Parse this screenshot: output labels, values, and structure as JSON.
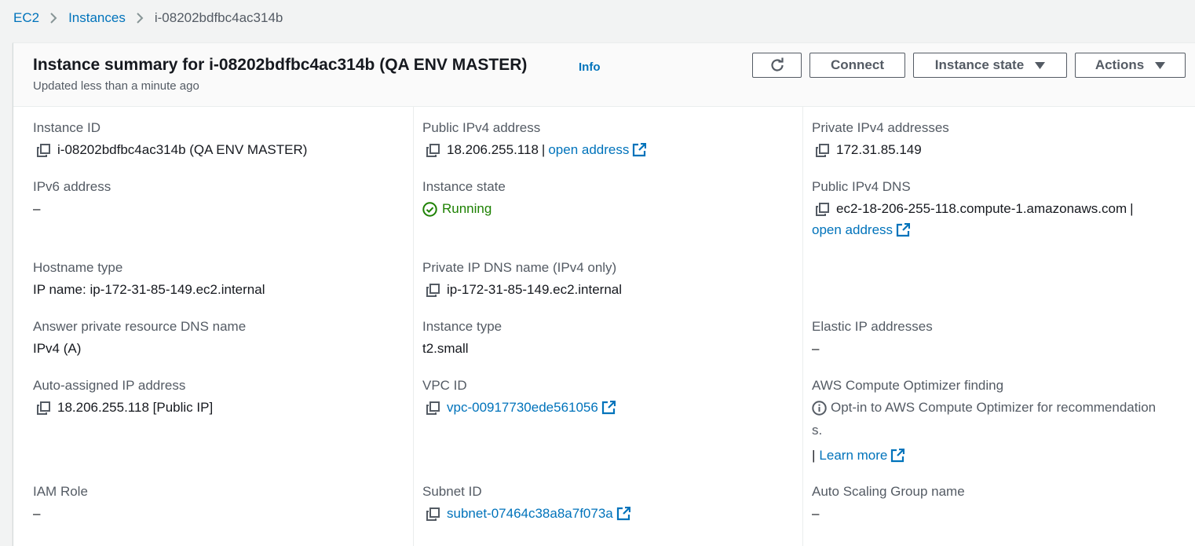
{
  "breadcrumb": {
    "items": [
      "EC2",
      "Instances"
    ],
    "current": "i-08202bdfbc4ac314b"
  },
  "header": {
    "title": "Instance summary for i-08202bdfbc4ac314b (QA ENV MASTER)",
    "info": "Info",
    "subtitle": "Updated less than a minute ago",
    "buttons": {
      "refresh_icon": "refresh-icon",
      "connect": "Connect",
      "instance_state": "Instance state",
      "actions": "Actions"
    }
  },
  "fields": {
    "instance_id": {
      "label": "Instance ID",
      "value": "i-08202bdfbc4ac314b (QA ENV MASTER)"
    },
    "ipv6": {
      "label": "IPv6 address",
      "value": "–"
    },
    "hostname_type": {
      "label": "Hostname type",
      "value": "IP name: ip-172-31-85-149.ec2.internal"
    },
    "answer_dns": {
      "label": "Answer private resource DNS name",
      "value": "IPv4 (A)"
    },
    "auto_ip": {
      "label": "Auto-assigned IP address",
      "value": "18.206.255.118 [Public IP]"
    },
    "iam_role": {
      "label": "IAM Role",
      "value": "–"
    },
    "public_ipv4": {
      "label": "Public IPv4 address",
      "value": "18.206.255.118",
      "sep": "|",
      "link": "open address"
    },
    "instance_state": {
      "label": "Instance state",
      "value": "Running"
    },
    "private_dns": {
      "label": "Private IP DNS name (IPv4 only)",
      "value": "ip-172-31-85-149.ec2.internal"
    },
    "instance_type": {
      "label": "Instance type",
      "value": "t2.small"
    },
    "vpc_id": {
      "label": "VPC ID",
      "value": "vpc-00917730ede561056"
    },
    "subnet_id": {
      "label": "Subnet ID",
      "value": "subnet-07464c38a8a7f073a"
    },
    "private_ipv4": {
      "label": "Private IPv4 addresses",
      "value": "172.31.85.149"
    },
    "public_dns": {
      "label": "Public IPv4 DNS",
      "value": "ec2-18-206-255-118.compute-1.amazonaws.com",
      "sep": "|",
      "link": "open address"
    },
    "elastic_ip": {
      "label": "Elastic IP addresses",
      "value": "–"
    },
    "optimizer": {
      "label": "AWS Compute Optimizer finding",
      "value_line1": "Opt-in to AWS Compute Optimizer for recommendation",
      "value_line2": "s.",
      "sep": "|",
      "link": "Learn more"
    },
    "asg": {
      "label": "Auto Scaling Group name",
      "value": "–"
    }
  },
  "colors": {
    "link": "#0073bb",
    "running": "#1d8102",
    "label": "#545b64"
  }
}
